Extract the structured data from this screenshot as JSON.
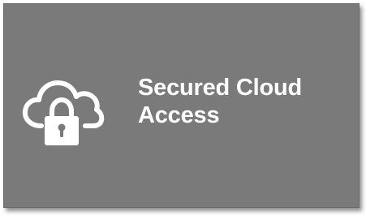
{
  "tile": {
    "title_line1": "Secured Cloud",
    "title_line2": "Access",
    "icon": "cloud-lock-icon",
    "background_color": "#7a7a7a",
    "text_color": "#ffffff"
  }
}
